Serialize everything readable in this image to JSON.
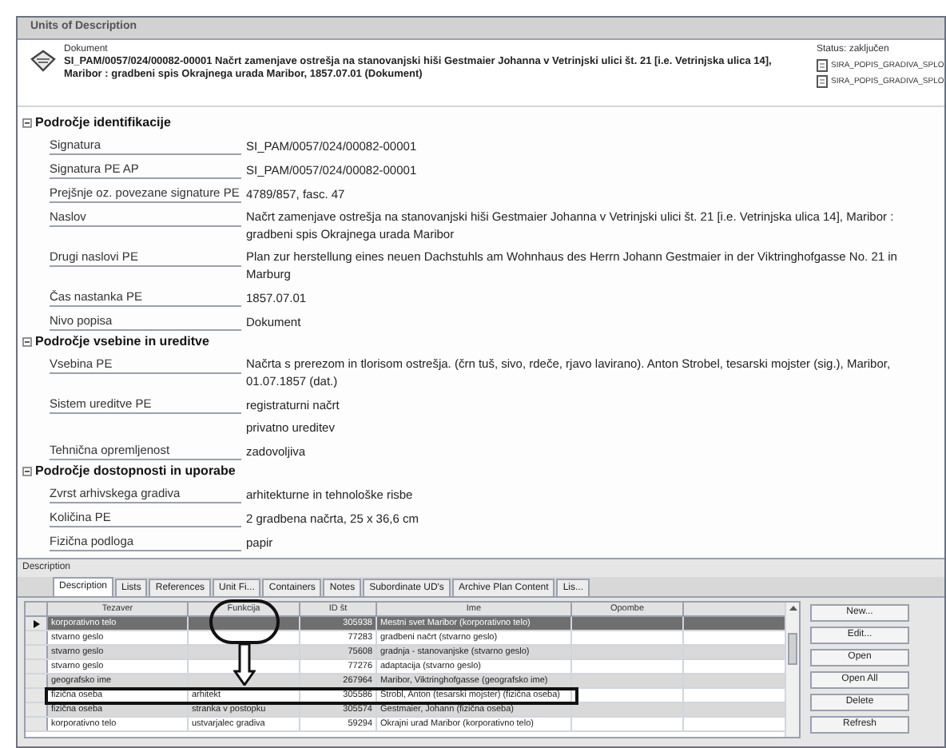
{
  "window": {
    "title": "Units of Description"
  },
  "header": {
    "type_label": "Dokument",
    "summary": "SI_PAM/0057/024/00082-00001   Načrt zamenjave ostrešja na stanovanjski hiši Gestmaier Johanna v Vetrinjski ulici št. 21 [i.e. Vetrinjska ulica 14], Maribor : gradbeni spis Okrajnega urada Maribor, 1857.07.01 (Dokument)",
    "status": "Status: zaključen",
    "attachments": [
      "SIRA_POPIS_GRADIVA_SPLO",
      "SIRA_POPIS_GRADIVA_SPLO"
    ]
  },
  "sections": [
    {
      "title": "Področje identifikacije",
      "expanded": true,
      "fields": [
        {
          "label": "Signatura",
          "value": "SI_PAM/0057/024/00082-00001"
        },
        {
          "label": "Signatura PE AP",
          "value": "SI_PAM/0057/024/00082-00001"
        },
        {
          "label": "Prejšnje oz. povezane signature PE",
          "value": "4789/857, fasc. 47"
        },
        {
          "label": "Naslov",
          "value": "Načrt zamenjave ostrešja na stanovanjski hiši Gestmaier Johanna v Vetrinjski ulici št. 21 [i.e. Vetrinjska ulica 14], Maribor : gradbeni spis Okrajnega urada Maribor"
        },
        {
          "label": "Drugi naslovi PE",
          "value": "Plan zur herstellung eines neuen Dachstuhls am Wohnhaus des Herrn Johann Gestmaier in der Viktringhofgasse No. 21 in Marburg"
        },
        {
          "label": "Čas nastanka PE",
          "value": "1857.07.01"
        },
        {
          "label": "Nivo popisa",
          "value": "Dokument"
        }
      ]
    },
    {
      "title": "Področje vsebine in ureditve",
      "expanded": true,
      "fields": [
        {
          "label": "Vsebina PE",
          "value": "Načrta s prerezom in tlorisom ostrešja. (črn tuš, sivo, rdeče, rjavo lavirano). Anton Strobel, tesarski mojster (sig.), Maribor, 01.07.1857 (dat.)"
        },
        {
          "label": "Sistem ureditve PE",
          "value": "registraturni načrt"
        },
        {
          "value": "privatno ureditev"
        },
        {
          "label": "Tehnična opremljenost",
          "value": "zadovoljiva"
        }
      ]
    },
    {
      "title": "Področje dostopnosti in uporabe",
      "expanded": true,
      "fields": [
        {
          "label": "Zvrst arhivskega gradiva",
          "value": "arhitekturne in tehnološke risbe"
        },
        {
          "label": "Količina PE",
          "value": "2 gradbena načrta, 25 x 36,6 cm"
        },
        {
          "label": "Fizična podloga",
          "value": "papir"
        }
      ]
    }
  ],
  "description_panel": {
    "label": "Description",
    "tabs": [
      {
        "label": "Description",
        "selected": true
      },
      {
        "label": "Lists",
        "selected": false
      },
      {
        "label": "References",
        "selected": false
      },
      {
        "label": "Unit Fi...",
        "selected": false
      },
      {
        "label": "Containers",
        "selected": false
      },
      {
        "label": "Notes",
        "selected": false
      },
      {
        "label": "Subordinate UD's",
        "selected": false
      },
      {
        "label": "Archive Plan Content",
        "selected": false
      },
      {
        "label": "Lis...",
        "selected": false
      }
    ],
    "table": {
      "columns": [
        {
          "label": "Tezaver",
          "circled": false
        },
        {
          "label": "Funkcija",
          "circled": true
        },
        {
          "label": "ID št",
          "circled": false
        },
        {
          "label": "Ime",
          "circled": false
        },
        {
          "label": "Opombe",
          "circled": false
        }
      ],
      "rows": [
        {
          "cells": [
            "korporativno telo",
            "",
            "305938",
            "Mestni svet Maribor (korporativno telo)",
            ""
          ],
          "selected": true,
          "boxed": false
        },
        {
          "cells": [
            "stvarno geslo",
            "",
            "77283",
            "gradbeni načrt (stvarno geslo)",
            ""
          ],
          "selected": false,
          "boxed": false
        },
        {
          "cells": [
            "stvarno geslo",
            "",
            "75608",
            "gradnja - stanovanjske (stvarno geslo)",
            ""
          ],
          "selected": false,
          "boxed": false
        },
        {
          "cells": [
            "stvarno geslo",
            "",
            "77276",
            "adaptacija (stvarno geslo)",
            ""
          ],
          "selected": false,
          "boxed": false
        },
        {
          "cells": [
            "geografsko ime",
            "",
            "267964",
            "Maribor, Viktringhofgasse (geografsko ime)",
            ""
          ],
          "selected": false,
          "boxed": false
        },
        {
          "cells": [
            "fizična oseba",
            "arhitekt",
            "305586",
            "Strobl, Anton (tesarski mojster) (fizična oseba)",
            ""
          ],
          "selected": false,
          "boxed": true
        },
        {
          "cells": [
            "fizična oseba",
            "stranka v postopku",
            "305574",
            "Gestmaier, Johann (fizična oseba)",
            ""
          ],
          "selected": false,
          "boxed": false
        },
        {
          "cells": [
            "korporativno telo",
            "ustvarjalec gradiva",
            "59294",
            "Okrajni urad Maribor (korporativno telo)",
            ""
          ],
          "selected": false,
          "boxed": false
        }
      ]
    },
    "buttons": [
      "New...",
      "Edit...",
      "Open",
      "Open All",
      "Delete",
      "Refresh"
    ]
  }
}
